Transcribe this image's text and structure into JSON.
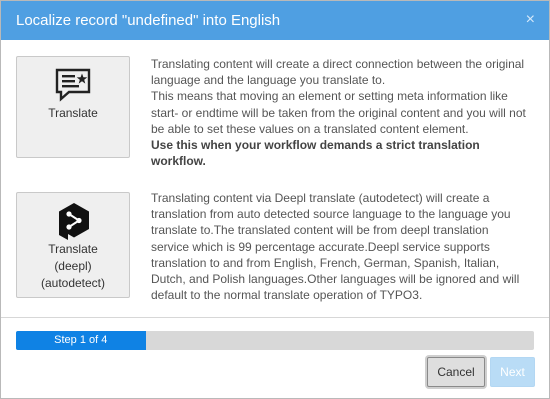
{
  "dialog": {
    "title": "Localize record \"undefined\" into English",
    "close_glyph": "×"
  },
  "options": [
    {
      "label": "Translate",
      "icon": "translate-chat-icon",
      "description": "Translating content will create a direct connection between the original language and the language you translate to.\nThis means that moving an element or setting meta information like start- or endtime will be taken from the original content and you will not be able to set these values on a translated content element.",
      "emphasis": "Use this when your workflow demands a strict translation workflow."
    },
    {
      "label": "Translate\n(deepl)\n(autodetect)",
      "icon": "deepl-logo-icon",
      "description": "Translating content via Deepl translate (autodetect) will create a translation from auto detected source language to the language you translate to.The translated content will be from deepl translation service which is 99 percentage accurate.Deepl service supports translation to and from English, French, German, Spanish, Italian, Dutch, and Polish languages.Other languages will be ignored and will default to the normal translate operation of TYPO3."
    }
  ],
  "progress": {
    "label": "Step 1 of 4",
    "percent": 25
  },
  "buttons": {
    "cancel": "Cancel",
    "next": "Next"
  },
  "colors": {
    "header": "#4f9fe2",
    "progress_fill": "#0f82e4",
    "next_disabled": "#b9dcf6"
  }
}
